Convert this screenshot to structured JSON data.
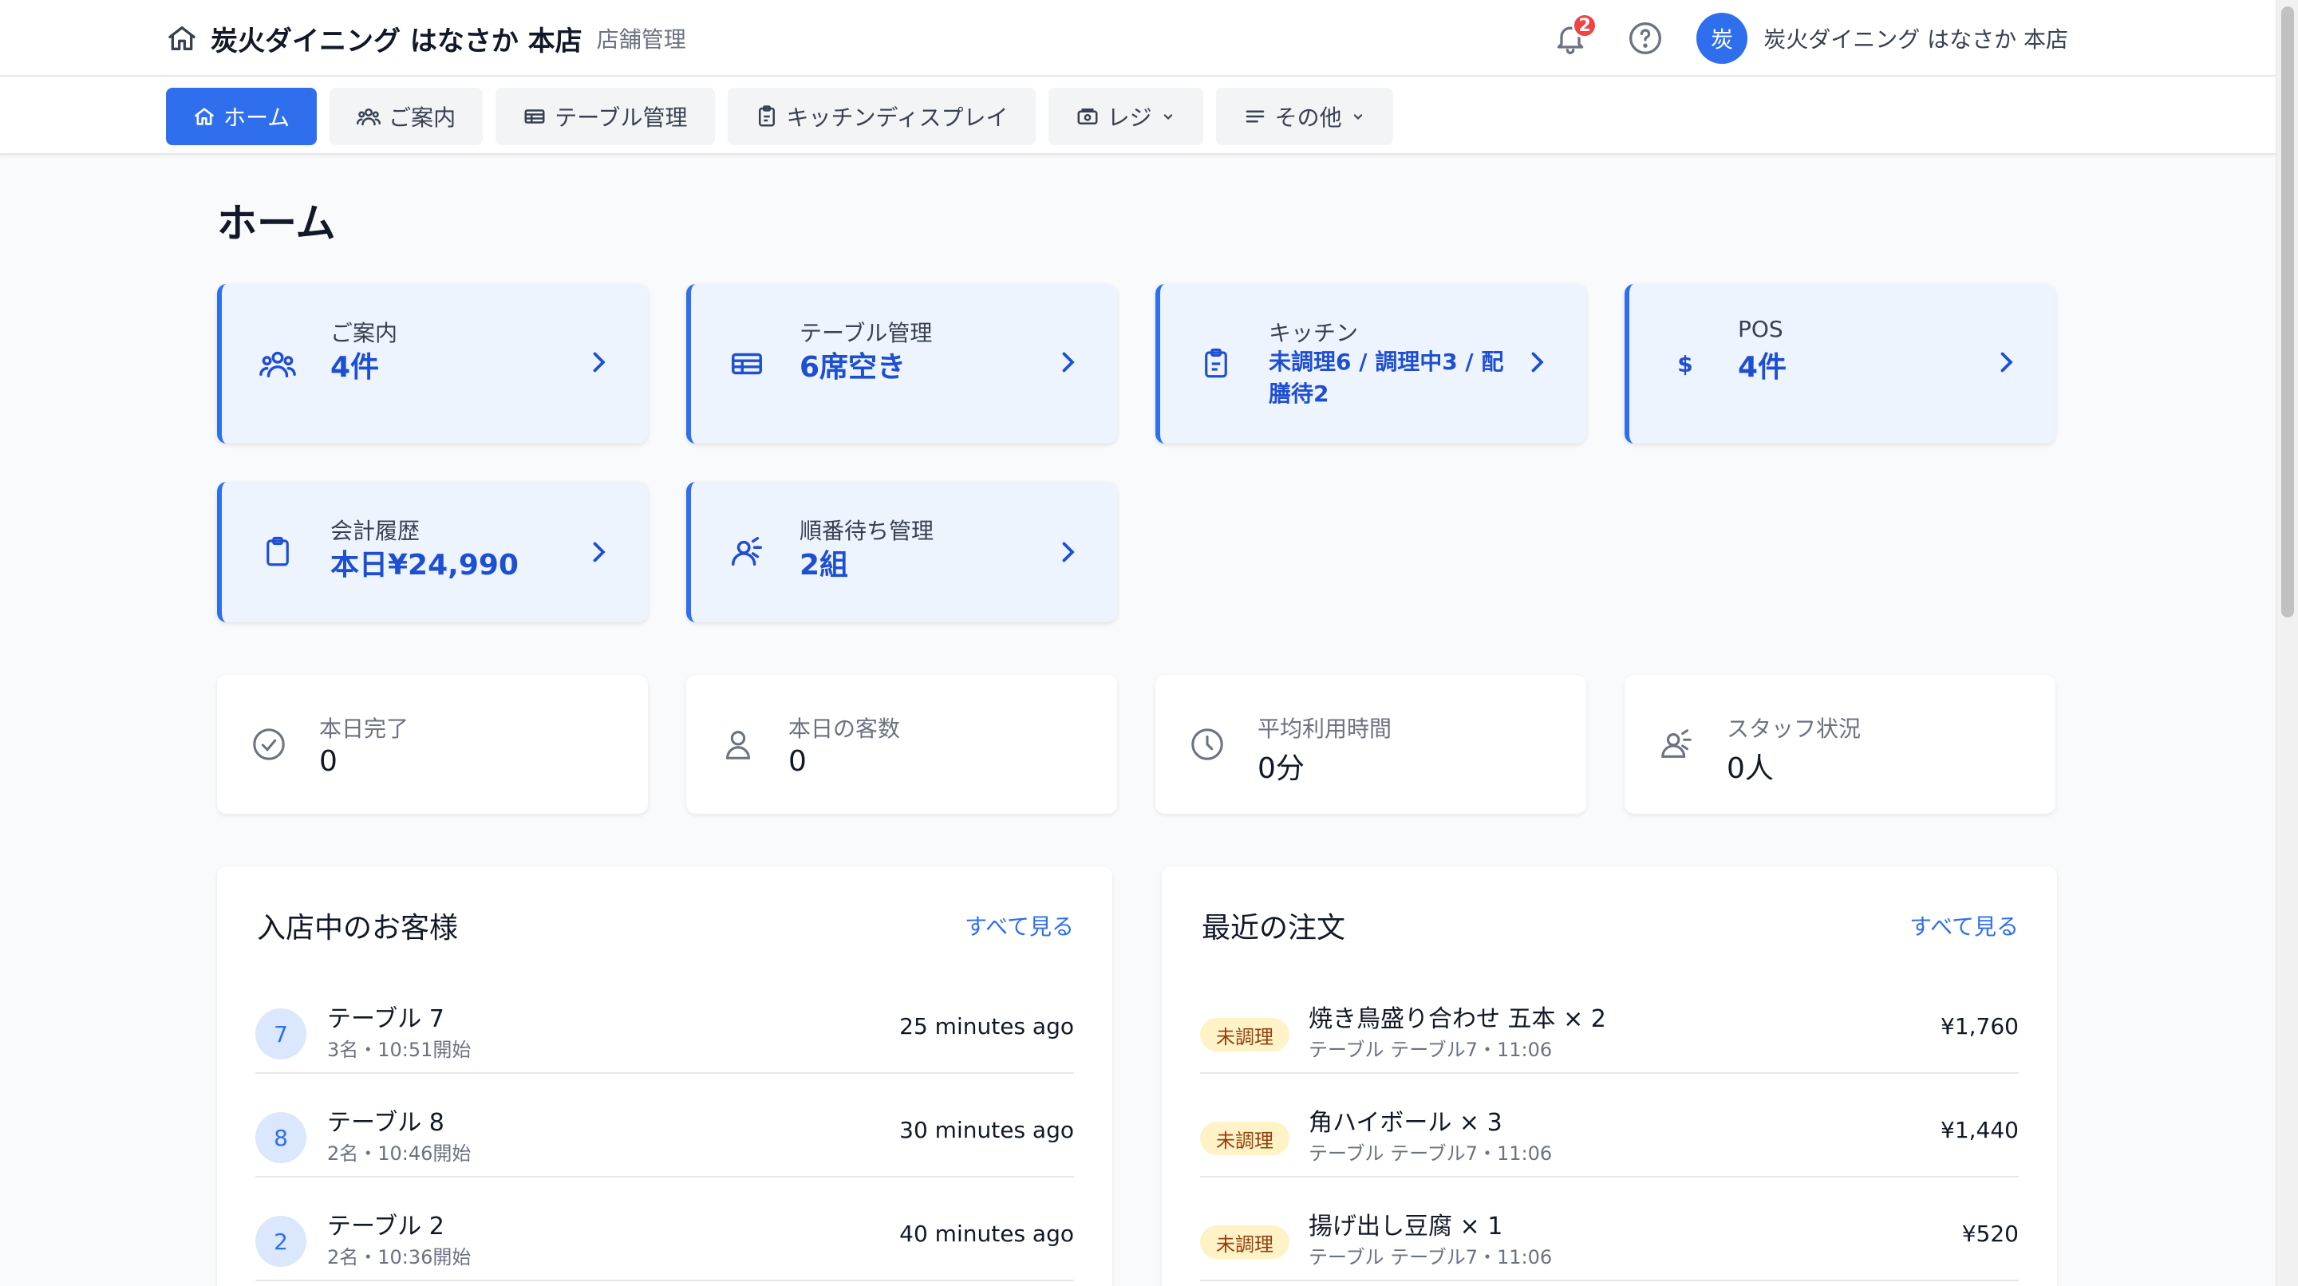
{
  "header": {
    "store_name": "炭火ダイニング はなさか 本店",
    "subtitle": "店舗管理",
    "notification_count": "2",
    "avatar_initial": "炭",
    "user_name": "炭火ダイニング はなさか 本店"
  },
  "nav": {
    "home": "ホーム",
    "reception": "ご案内",
    "tables": "テーブル管理",
    "kitchen": "キッチンディスプレイ",
    "register": "レジ",
    "other": "その他"
  },
  "page": {
    "title": "ホーム"
  },
  "cards": [
    {
      "label": "ご案内",
      "value": "4件",
      "icon": "users-icon"
    },
    {
      "label": "テーブル管理",
      "value": "6席空き",
      "icon": "table-icon"
    },
    {
      "label": "キッチン",
      "value": "未調理6 / 調理中3 / 配膳待2",
      "icon": "clipboard-icon"
    },
    {
      "label": "POS",
      "value": "4件",
      "icon": "dollar-icon"
    },
    {
      "label": "会計履歴",
      "value": "本日¥24,990",
      "icon": "clipboard-icon"
    },
    {
      "label": "順番待ち管理",
      "value": "2組",
      "icon": "queue-icon"
    }
  ],
  "stats": [
    {
      "label": "本日完了",
      "value": "0",
      "icon": "check-circle-icon"
    },
    {
      "label": "本日の客数",
      "value": "0",
      "icon": "user-icon"
    },
    {
      "label": "平均利用時間",
      "value": "0分",
      "icon": "clock-icon"
    },
    {
      "label": "スタッフ状況",
      "value": "0人",
      "icon": "staff-icon"
    }
  ],
  "guests": {
    "title": "入店中のお客様",
    "link": "すべて見る",
    "rows": [
      {
        "num": "7",
        "table": "テーブル 7",
        "detail": "3名・10:51開始",
        "ago": "25 minutes ago"
      },
      {
        "num": "8",
        "table": "テーブル 8",
        "detail": "2名・10:46開始",
        "ago": "30 minutes ago"
      },
      {
        "num": "2",
        "table": "テーブル 2",
        "detail": "2名・10:36開始",
        "ago": "40 minutes ago"
      }
    ]
  },
  "orders": {
    "title": "最近の注文",
    "link": "すべて見る",
    "rows": [
      {
        "status": "未調理",
        "item": "焼き鳥盛り合わせ 五本 × 2",
        "detail": "テーブル テーブル7・11:06",
        "price": "¥1,760"
      },
      {
        "status": "未調理",
        "item": "角ハイボール × 3",
        "detail": "テーブル テーブル7・11:06",
        "price": "¥1,440"
      },
      {
        "status": "未調理",
        "item": "揚げ出し豆腐 × 1",
        "detail": "テーブル テーブル7・11:06",
        "price": "¥520"
      }
    ]
  },
  "colors": {
    "accent": "#2f6fed",
    "card_bg": "#eef4fe",
    "value_blue": "#1e4fd1",
    "badge_red": "#ef4444",
    "tag_bg": "#fef3c7"
  }
}
